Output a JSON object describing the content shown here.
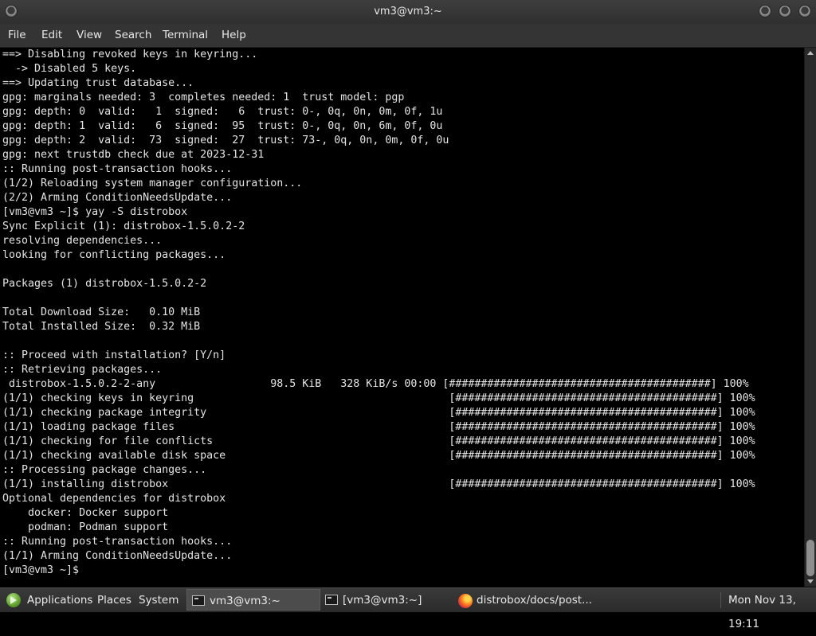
{
  "window": {
    "title": "vm3@vm3:~"
  },
  "menu": [
    "File",
    "Edit",
    "View",
    "Search",
    "Terminal",
    "Help"
  ],
  "terminal": {
    "lines": [
      "==> Disabling revoked keys in keyring...",
      "  -> Disabled 5 keys.",
      "==> Updating trust database...",
      "gpg: marginals needed: 3  completes needed: 1  trust model: pgp",
      "gpg: depth: 0  valid:   1  signed:   6  trust: 0-, 0q, 0n, 0m, 0f, 1u",
      "gpg: depth: 1  valid:   6  signed:  95  trust: 0-, 0q, 0n, 6m, 0f, 0u",
      "gpg: depth: 2  valid:  73  signed:  27  trust: 73-, 0q, 0n, 0m, 0f, 0u",
      "gpg: next trustdb check due at 2023-12-31",
      ":: Running post-transaction hooks...",
      "(1/2) Reloading system manager configuration...",
      "(2/2) Arming ConditionNeedsUpdate...",
      "[vm3@vm3 ~]$ yay -S distrobox",
      "Sync Explicit (1): distrobox-1.5.0.2-2",
      "resolving dependencies...",
      "looking for conflicting packages...",
      "",
      "Packages (1) distrobox-1.5.0.2-2",
      "",
      "Total Download Size:   0.10 MiB",
      "Total Installed Size:  0.32 MiB",
      "",
      ":: Proceed with installation? [Y/n]",
      ":: Retrieving packages...",
      " distrobox-1.5.0.2-2-any                  98.5 KiB   328 KiB/s 00:00 [#########################################] 100%",
      "(1/1) checking keys in keyring                                        [#########################################] 100%",
      "(1/1) checking package integrity                                      [#########################################] 100%",
      "(1/1) loading package files                                           [#########################################] 100%",
      "(1/1) checking for file conflicts                                     [#########################################] 100%",
      "(1/1) checking available disk space                                   [#########################################] 100%",
      ":: Processing package changes...",
      "(1/1) installing distrobox                                            [#########################################] 100%",
      "Optional dependencies for distrobox",
      "    docker: Docker support",
      "    podman: Podman support",
      ":: Running post-transaction hooks...",
      "(1/1) Arming ConditionNeedsUpdate...",
      "[vm3@vm3 ~]$ "
    ]
  },
  "taskbar": {
    "applications": "Applications",
    "places": "Places",
    "system": "System",
    "tasks": [
      {
        "label": "vm3@vm3:~",
        "icon": "terminal-icon",
        "active": true
      },
      {
        "label": "[vm3@vm3:~]",
        "icon": "terminal-icon",
        "active": false
      },
      {
        "label": "distrobox/docs/post...",
        "icon": "firefox-icon",
        "active": false
      }
    ],
    "clock": "Mon Nov 13, 19:11"
  }
}
